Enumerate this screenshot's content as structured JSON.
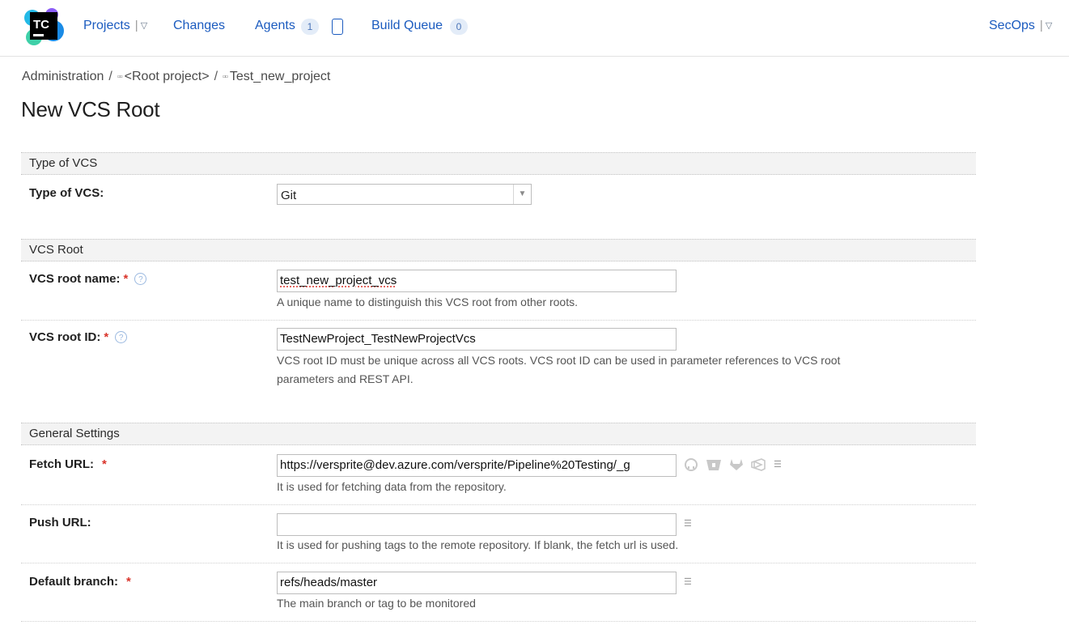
{
  "header": {
    "logo_text": "TC",
    "nav": {
      "projects": "Projects",
      "changes": "Changes",
      "agents": "Agents",
      "agents_count": "1",
      "build_queue": "Build Queue",
      "build_queue_count": "0",
      "user": "SecOps"
    }
  },
  "breadcrumb": {
    "admin": "Administration",
    "root": "<Root project>",
    "project": "Test_new_project"
  },
  "page_title": "New VCS Root",
  "sections": {
    "type_of_vcs": "Type of VCS",
    "vcs_root": "VCS Root",
    "general_settings": "General Settings"
  },
  "fields": {
    "type_label": "Type of VCS:",
    "type_value": "Git",
    "name_label": "VCS root name:",
    "name_value": "test_new_project_vcs",
    "name_hint": "A unique name to distinguish this VCS root from other roots.",
    "id_label": "VCS root ID:",
    "id_value": "TestNewProject_TestNewProjectVcs",
    "id_hint_1": "VCS root ID must be unique across all VCS roots. VCS root ID can be used in parameter references to VCS root",
    "id_hint_2": "parameters and REST API.",
    "fetch_label": "Fetch URL:",
    "fetch_value": "https://versprite@dev.azure.com/versprite/Pipeline%20Testing/_g",
    "fetch_hint": "It is used for fetching data from the repository.",
    "push_label": "Push URL:",
    "push_value": "",
    "push_hint": "It is used for pushing tags to the remote repository. If blank, the fetch url is used.",
    "branch_label": "Default branch:",
    "branch_value": "refs/heads/master",
    "branch_hint": "The main branch or tag to be monitored"
  },
  "icons": {
    "vcs_providers": [
      "github-icon",
      "bitbucket-icon",
      "gitlab-icon",
      "azure-devops-icon"
    ],
    "list": "list-icon",
    "help": "question-mark-icon"
  },
  "colors": {
    "link": "#1b5bbf",
    "required": "#d9342b",
    "section_bg": "#f3f3f3"
  }
}
